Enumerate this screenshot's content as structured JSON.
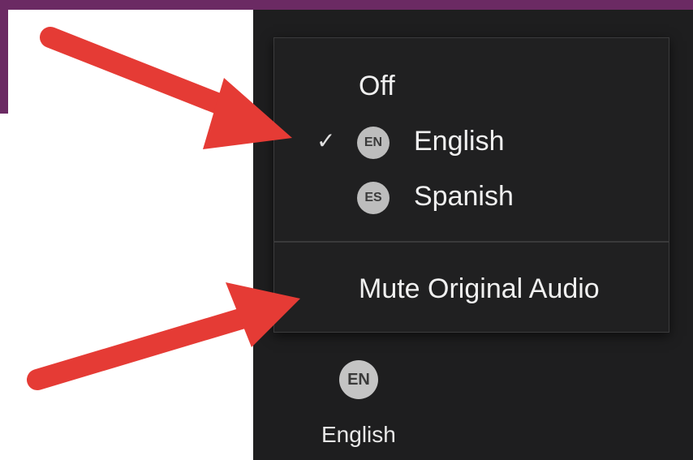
{
  "menu": {
    "items": [
      {
        "label": "Off"
      },
      {
        "label": "English",
        "badge": "EN",
        "checked": true
      },
      {
        "label": "Spanish",
        "badge": "ES",
        "checked": false
      }
    ],
    "mute_label": "Mute Original Audio",
    "check_glyph": "✓"
  },
  "interpretation_button": {
    "badge": "EN",
    "label": "English"
  },
  "colors": {
    "accent_purple": "#6b2a63",
    "menu_background": "#202021",
    "arrow_red": "#e53b35"
  },
  "icons": [
    "checkmark-icon",
    "language-badge-icon",
    "red-arrow-icon"
  ]
}
